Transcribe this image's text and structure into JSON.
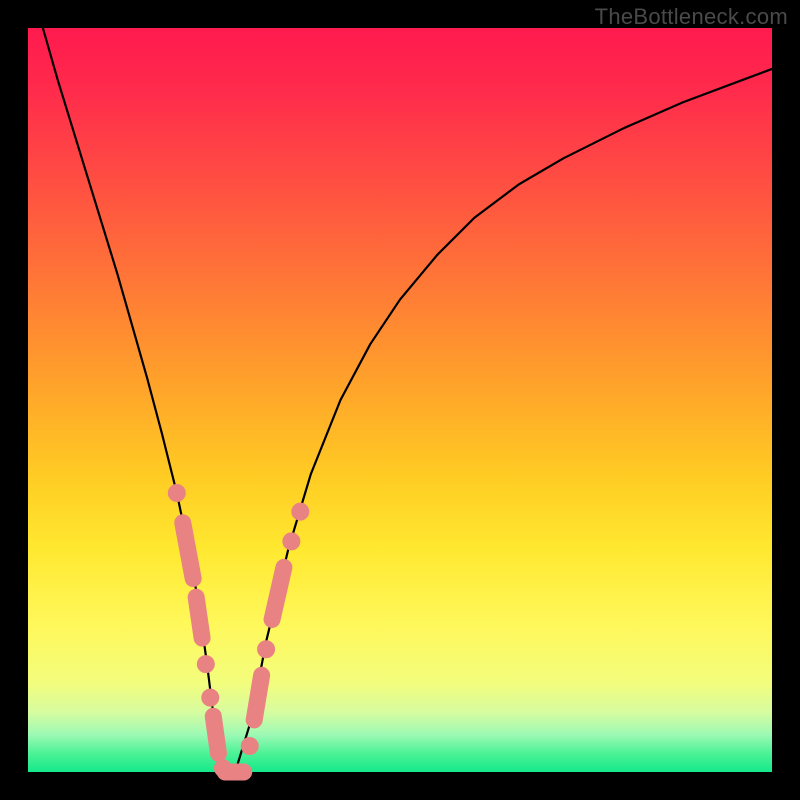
{
  "watermark": "TheBottleneck.com",
  "colors": {
    "background_black": "#000000",
    "gradient_top": "#ff1a4e",
    "gradient_bottom": "#14e98a",
    "curve": "#000000",
    "marker": "#e98383",
    "watermark_text": "#4a4a4a"
  },
  "chart_data": {
    "type": "line",
    "title": "",
    "xlabel": "",
    "ylabel": "",
    "xlim": [
      0,
      100
    ],
    "ylim": [
      0,
      100
    ],
    "grid": false,
    "legend": false,
    "series": [
      {
        "name": "bottleneck-curve",
        "x": [
          2,
          4,
          6,
          8,
          10,
          12,
          14,
          16,
          18,
          20,
          22,
          23,
          24,
          25,
          26,
          27,
          28,
          30,
          32,
          35,
          38,
          42,
          46,
          50,
          55,
          60,
          66,
          72,
          80,
          88,
          96,
          100
        ],
        "y": [
          100,
          93,
          86.5,
          80,
          73.5,
          67,
          60,
          53,
          45.5,
          37.5,
          28,
          22,
          15,
          7,
          1,
          0,
          0.5,
          7,
          17.5,
          30,
          40,
          50,
          57.5,
          63.5,
          69.5,
          74.5,
          79,
          82.5,
          86.5,
          90,
          93,
          94.5
        ]
      }
    ],
    "markers": {
      "left_branch": [
        {
          "type": "dot",
          "x": 20.0,
          "y": 37.5
        },
        {
          "type": "pill",
          "x1": 20.8,
          "y1": 33.5,
          "x2": 22.2,
          "y2": 26.0
        },
        {
          "type": "pill",
          "x1": 22.6,
          "y1": 23.5,
          "x2": 23.4,
          "y2": 18.0
        },
        {
          "type": "dot",
          "x": 23.9,
          "y": 14.5
        },
        {
          "type": "dot",
          "x": 24.5,
          "y": 10.0
        },
        {
          "type": "pill",
          "x1": 24.9,
          "y1": 7.5,
          "x2": 25.6,
          "y2": 2.5
        },
        {
          "type": "dot",
          "x": 26.2,
          "y": 0.5
        }
      ],
      "trough": [
        {
          "type": "pill",
          "x1": 26.5,
          "y1": 0.0,
          "x2": 29.0,
          "y2": 0.0
        }
      ],
      "right_branch": [
        {
          "type": "dot",
          "x": 29.8,
          "y": 3.5
        },
        {
          "type": "pill",
          "x1": 30.4,
          "y1": 7.0,
          "x2": 31.4,
          "y2": 13.0
        },
        {
          "type": "dot",
          "x": 32.0,
          "y": 16.5
        },
        {
          "type": "pill",
          "x1": 32.8,
          "y1": 20.5,
          "x2": 34.4,
          "y2": 27.5
        },
        {
          "type": "dot",
          "x": 35.4,
          "y": 31.0
        },
        {
          "type": "dot",
          "x": 36.6,
          "y": 35.0
        }
      ]
    }
  }
}
